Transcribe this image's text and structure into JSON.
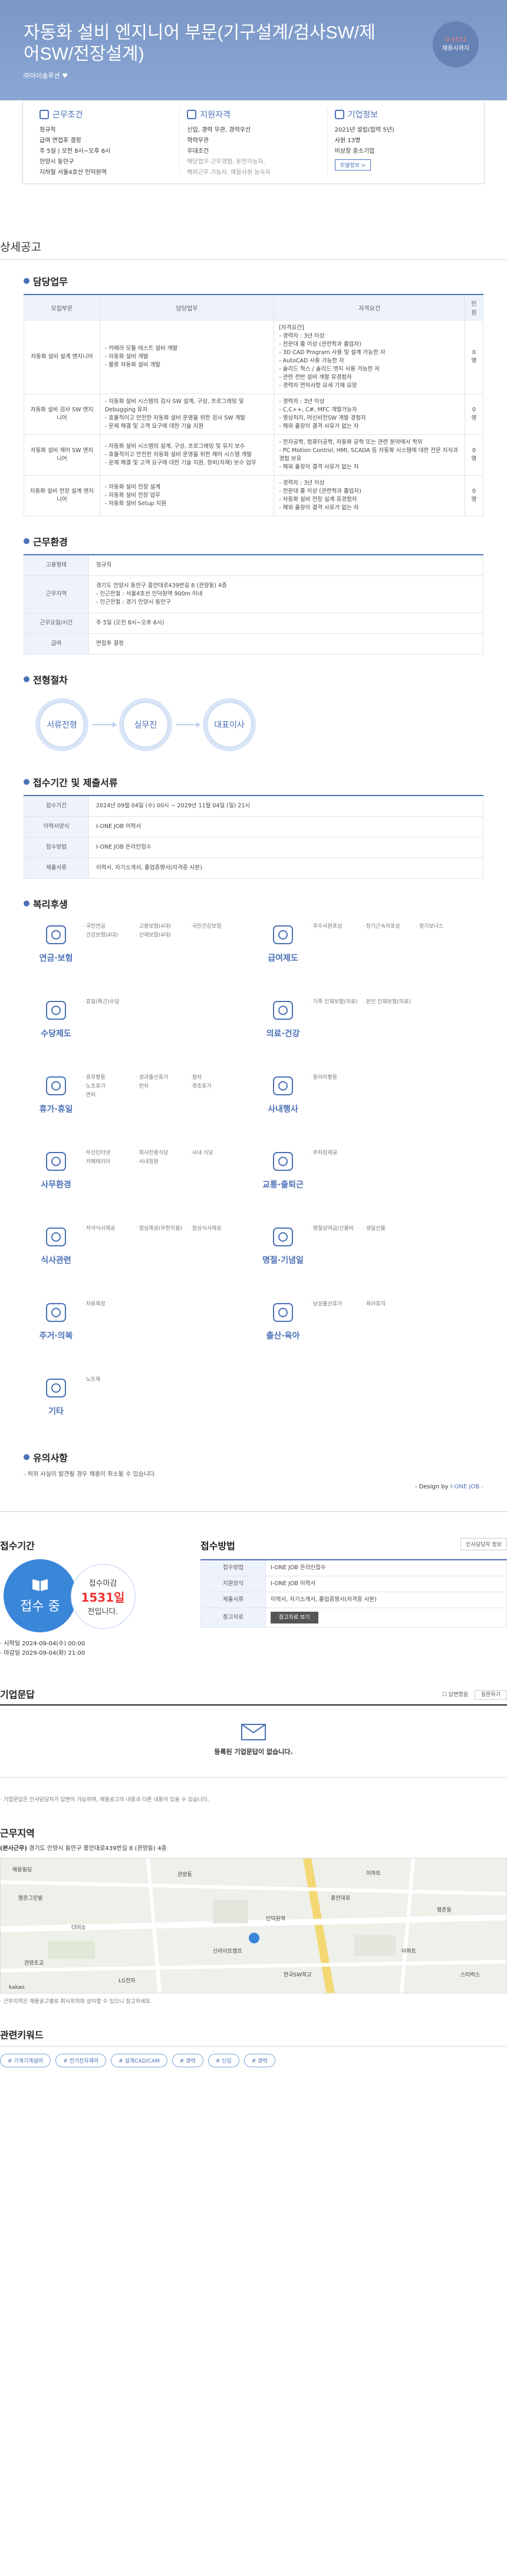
{
  "header": {
    "title": "자동화 설비 엔지니어 부문(기구설계/검사SW/제어SW/전장설계)",
    "company": "㈜아이솔루션",
    "badge": {
      "line1": "D-1531",
      "line2": "채용시까지"
    }
  },
  "info": {
    "cond": {
      "title": "근무조건",
      "lines": [
        "정규직",
        "급여 면접후 결정",
        "주 5일 | 오전 8시~오후 6시",
        "안양시 동안구",
        "지하철 서울4호선 인덕원역"
      ]
    },
    "qual": {
      "title": "지원자격",
      "lines": [
        "신입, 경력 무관, 경력우선",
        "학력무관",
        "우대조건",
        "해당업무 근무경험, 운전가능자,",
        "해외근무 가능자, 예들사원 능숙자"
      ]
    },
    "corp": {
      "title": "기업정보",
      "lines": [
        "2021년 설립(업력 5년)",
        "사원 13명",
        "비상장 중소기업"
      ],
      "btn": "모델정보 >"
    }
  },
  "detail": {
    "title": "상세공고",
    "duty": {
      "title": "담당업무",
      "headers": [
        "모집부문",
        "담당업무",
        "자격요건",
        "인원"
      ],
      "rows": [
        {
          "part": "자동화 설비 설계 엔지니어",
          "task": "- 카메라 모듈 테스트 설비 개발\n- 자동화 설비 개발\n- 물류 자동화 설비 개발",
          "req": "[자격요건]\n- 경력자 : 3년 이상\n- 전문대 졸 이상 (관련학과 졸업자)\n- 3D CAD Program 사용 및 설계 가능한 자\n- AutoCAD 사용 가능한 자\n- 솔리드 웍스 / 솔리드 엣지 사용 가능한 자\n- 관련 전반 설비 개발 유경험자\n- 경력자 면허사항 요세 기재 요망",
          "n": "0명"
        },
        {
          "part": "자동화 설비 검사 SW 엔지니어",
          "task": "- 자동화 설비 시스템의 검사 SW 설계, 구성, 프로그래밍 및 Debugging 유지\n- 효율적이고 안전한 자동화 설비 운영을 위한 검사 SW 개발\n- 문제 해결 및 고객 요구에 대한 기술 지원",
          "req": "- 경력자 : 3년 이상\n- C,C++, C#, MFC 개발가능자\n- 영상처리, 머신비전SW 개발 경험자\n- 해외 출장이 결격 사유가 없는 자",
          "n": "0명"
        },
        {
          "part": "자동화 설비 제어 SW 엔지니어",
          "task": "- 자동화 설비 시스템의 설계, 구성, 프로그래밍 및 유지 보수\n- 효율적이고 안전한 자동화 설비 운영을 위한 제어 시스템 개발\n- 문제 해결 및 고객 요구에 대한 기술 지원, 장비(자재) 보수 업무",
          "req": "- 전자공학, 컴퓨터공학, 자동화 공학 또는 관련 분야에서 학위\n- PC Motion Control, HMI, SCADA 등 자동화 시스템에 대한 전문 지식과 경험 보유\n- 해외 출장이 결격 사유가 없는 자",
          "n": "0명"
        },
        {
          "part": "자동화 설비 전장 설계 엔지니어",
          "task": "- 자동화 설비 전장 설계\n- 자동화 설비 전장 업무\n- 자동화 설비 Setup 지원",
          "req": "- 경력자 : 3년 이상\n- 전문대 졸 이상 (관련학과 졸업자)\n- 자동화 설비 전장 설계 유경험자\n- 해외 출장이 결격 사유가 없는 자",
          "n": "0명"
        }
      ]
    },
    "env": {
      "title": "근무환경",
      "rows": [
        {
          "k": "고용형태",
          "v": "정규직"
        },
        {
          "k": "근무지역",
          "v": "경기도 안양시 동안구 흥안대로439번길 8 (관양동) 4층\n- 인근전철 : 서울4호선 인덕원역 900m 이내\n- 인근전철 : 경기 안양시 동안구"
        },
        {
          "k": "근무요일/시간",
          "v": "주 5일 (오전 8시~오후 6시)"
        },
        {
          "k": "급여",
          "v": "면접후 결정"
        }
      ]
    },
    "process": {
      "title": "전형절차",
      "steps": [
        "서류전형",
        "실무진",
        "대표이사"
      ]
    },
    "period": {
      "title": "접수기간 및 제출서류",
      "rows": [
        {
          "k": "접수기간",
          "v": "2024년 09월 04일 (수) 00시 ~ 2029년 11월 04일 (일) 21시"
        },
        {
          "k": "이력서양식",
          "v": "I-ONE JOB 이력서"
        },
        {
          "k": "접수방법",
          "v": "I-ONE JOB 온라인접수"
        },
        {
          "k": "제출서류",
          "v": "이력서, 자기소개서, 졸업증명서(자격증 사본)"
        }
      ]
    },
    "welfare": {
      "title": "복리후생",
      "items": [
        {
          "name": "연금·보험",
          "icon": "person-icon",
          "list": [
            "국민연금",
            "고용보험(4대)",
            "국민건강보험",
            "건강보험(4대)",
            "산재보험(4대)"
          ]
        },
        {
          "name": "급여제도",
          "icon": "money-icon",
          "list": [
            "우수사원포상",
            "장기근속자포상",
            "정기보너스"
          ]
        },
        {
          "name": "수당제도",
          "icon": "gamepad-icon",
          "list": [
            "휴일(특근)수당"
          ]
        },
        {
          "name": "의료·건강",
          "icon": "medical-icon",
          "list": [
            "가족 인재보험(의료)",
            "본인 인재보험(의료)"
          ]
        },
        {
          "name": "휴가·휴일",
          "icon": "calendar-icon",
          "list": [
            "휴무활동",
            "성과출산휴가",
            "월차",
            "노조휴가",
            "반차",
            "경조휴가",
            "연차"
          ]
        },
        {
          "name": "사내행사",
          "icon": "event-icon",
          "list": [
            "동아리활동"
          ]
        },
        {
          "name": "사무환경",
          "icon": "monitor-icon",
          "list": [
            "무선인터넷",
            "회사전용식당",
            "사내 식당",
            "카페테리아",
            "사내정원"
          ]
        },
        {
          "name": "교통·출퇴근",
          "icon": "car-icon",
          "list": [
            "주차장제공"
          ]
        },
        {
          "name": "식사관련",
          "icon": "bowl-icon",
          "list": [
            "저녁식사제공",
            "점심제공(무한리필)",
            "점심식사제공"
          ]
        },
        {
          "name": "명절·기념일",
          "icon": "gift-icon",
          "list": [
            "명절상여금/선물비",
            "생일선물"
          ]
        },
        {
          "name": "주거·의복",
          "icon": "house-icon",
          "list": [
            "자유복장"
          ]
        },
        {
          "name": "출산·육아",
          "icon": "baby-icon",
          "list": [
            "남성출산휴가",
            "육아휴직"
          ]
        },
        {
          "name": "기타",
          "icon": "shapes-icon",
          "list": [
            "노트북"
          ]
        }
      ]
    },
    "caution": {
      "title": "유의사항",
      "text": "- 허위 사실이 발견될 경우 채용이 취소될 수 있습니다.",
      "design": "- Design by ",
      "brand": "I-ONE JOB -"
    }
  },
  "apply": {
    "period_title": "접수기간",
    "status": "접수 중",
    "deadline_label": "접수마감",
    "dday": "1531일",
    "remain": "전입니다.",
    "start": "· 시작일 2024-09-04(수) 00:00",
    "end": "· 마감일 2029-09-04(화) 21:00",
    "method_title": "접수방법",
    "top_btn": "인사담당자 정보",
    "rows": [
      {
        "k": "접수방법",
        "v": "I-ONE JOB 온라인접수"
      },
      {
        "k": "지원양식",
        "v": "I-ONE JOB 이력서"
      },
      {
        "k": "제출서류",
        "v": "이력서, 자기소개서, 졸업증명서(자격증 사본)"
      },
      {
        "k": "참고자료",
        "v": "참고자료 보기"
      }
    ]
  },
  "qa": {
    "title": "기업문답",
    "checkbox": "답변했음",
    "sort": "질문하기",
    "empty": "등록된 기업문답이 없습니다."
  },
  "notice": "· 기업문답은 인사담당자가 답변이 가능하며, 채용공고의 내용과 다른 내용이 있을 수 있습니다.",
  "location": {
    "title": "근무지역",
    "addr_label": "(본사근무)",
    "addr": "경기도 안양시 동안구 흥안대로439번길 8 (관양동) 4층",
    "map_labels": [
      "해동빌딩",
      "평촌그린빌",
      "관양동",
      "인덕원역",
      "흥안대로",
      "다이소",
      "관양초교",
      "신라이트캠프",
      "이마트",
      "평촌동",
      "LG전자",
      "아파트",
      "스타벅스",
      "한국SW학교",
      "kakao"
    ],
    "note": "· 근무지역은 채용공고별로 회사위치와 상이할 수 있으니 참고하세요."
  },
  "keywords": {
    "title": "관련키워드",
    "tags": [
      "# 기계기계설비",
      "# 전기전자제어",
      "# 설계CAD/CAM",
      "# 경력",
      "# 신입",
      "# 경력"
    ]
  }
}
